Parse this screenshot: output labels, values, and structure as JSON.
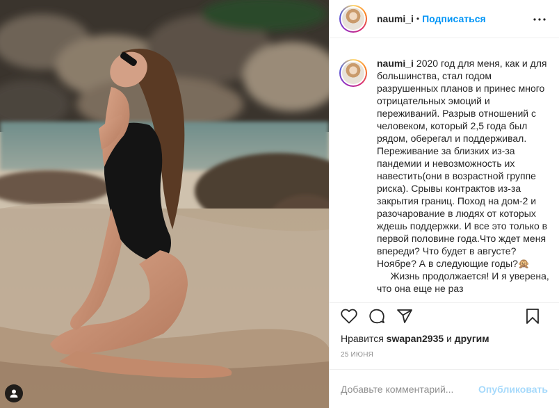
{
  "post": {
    "photo_alt": "",
    "username": "naumi_i",
    "separator": "•",
    "follow_label": "Подписаться",
    "caption": "2020 год для меня, как и для большинства, стал годом разрушенных планов и принес много отрицательных эмоций и переживаний.⁣⁣ Разрыв отношений с человеком, который 2,5 года был рядом, оберегал и поддерживал. Переживание за близких из-за пандемии и невозможность их навестить(они в возрастной группе риска). Срывы контрактов из-за закрытия границ. Поход на дом-2 и разочарование в людях от которых ждешь поддержки. И все это только в первой половине года.Что ждет меня впереди? Что будет в августе? Ноябре? А в следующие годы?🙊\n     Жизнь продолжается! И я уверена, что она еще не раз",
    "likes_prefix": "Нравится",
    "likes_user": "swapan2935",
    "likes_and": "и",
    "likes_others": "другим",
    "date": "25 июня",
    "comment_placeholder": "Добавьте комментарий...",
    "publish_label": "Опубликовать"
  },
  "icons": {
    "more": "more-options-icon",
    "like": "heart-icon",
    "comment": "comment-icon",
    "share": "share-icon",
    "save": "bookmark-icon",
    "tagged_user": "user-tag-icon"
  },
  "colors": {
    "accent": "#0095f6",
    "text": "#262626",
    "muted": "#8e8e8e",
    "border": "#efefef"
  }
}
